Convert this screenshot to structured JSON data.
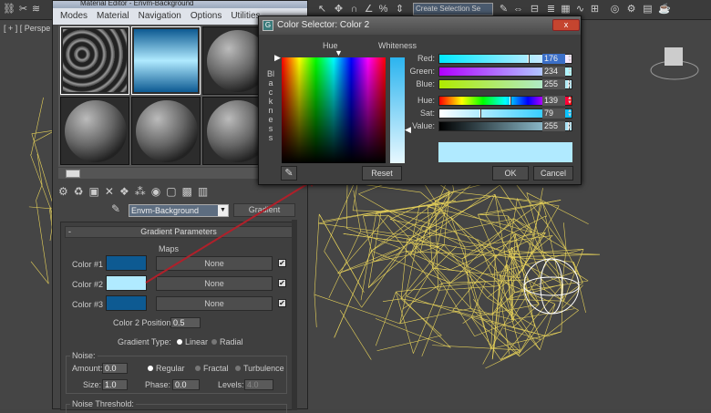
{
  "toolbar": {
    "selection_set_placeholder": "Create Selection Se",
    "icons": [
      "link-icon",
      "unlink-icon",
      "bind-icon",
      "select-icon",
      "move-icon",
      "snap-icon",
      "angle-snap-icon",
      "percent-snap-icon",
      "spinner-snap-icon",
      "edit-named-selection-icon",
      "mirror-icon",
      "align-icon",
      "layer-icon",
      "graphite-icon",
      "curve-editor-icon",
      "schematic-icon",
      "material-editor-icon",
      "render-setup-icon",
      "render-frame-icon",
      "render-icon"
    ]
  },
  "viewport": {
    "label": "[ + ] [ Perspe",
    "wire_color": "#e8d35a"
  },
  "material_editor": {
    "title": "Material Editor - Envm-Background",
    "menu": [
      "Modes",
      "Material",
      "Navigation",
      "Options",
      "Utilities"
    ],
    "map_name": "Envm-Background",
    "map_type": "Gradient",
    "rollout": {
      "title": "Gradient Parameters",
      "collapse": "-",
      "maps_label": "Maps",
      "colors": [
        {
          "label": "Color #1",
          "color": "#0d5a92",
          "map": "None",
          "checked": true
        },
        {
          "label": "Color #2",
          "color": "#b0eaff",
          "map": "None",
          "checked": true
        },
        {
          "label": "Color #3",
          "color": "#0d5a92",
          "map": "None",
          "checked": true
        }
      ],
      "color2_position_label": "Color 2 Position:",
      "color2_position": "0.5",
      "gradient_type_label": "Gradient Type:",
      "gradient_types": [
        "Linear",
        "Radial"
      ],
      "gradient_type_selected": "Linear",
      "noise_label": "Noise:",
      "amount_label": "Amount:",
      "amount": "0.0",
      "noise_types": [
        "Regular",
        "Fractal",
        "Turbulence"
      ],
      "noise_type_selected": "Regular",
      "size_label": "Size:",
      "size": "1.0",
      "phase_label": "Phase:",
      "phase": "0.0",
      "levels_label": "Levels:",
      "levels": "4.0",
      "noise_threshold_label": "Noise Threshold:"
    }
  },
  "color_selector": {
    "title": "Color Selector: Color 2",
    "close": "x",
    "hue_label": "Hue",
    "whiteness_label": "Whiteness",
    "blackness_label": "Blackness",
    "channels": [
      {
        "label": "Red:",
        "value": "176",
        "fraction": 0.69,
        "gradient": "linear-gradient(to right,#00eaff,#b0eaff 69%,#ffeaff)",
        "selected": true
      },
      {
        "label": "Green:",
        "value": "234",
        "fraction": 0.92,
        "gradient": "linear-gradient(to right,#b000ff,#b0eaff 92%,#b0ffff)"
      },
      {
        "label": "Blue:",
        "value": "255",
        "fraction": 1.0,
        "gradient": "linear-gradient(to right,#b0ea00,#b0eaff)"
      },
      {
        "label": "Hue:",
        "value": "139",
        "fraction": 0.545,
        "gradient": "linear-gradient(to right,#f00,#ff0 17%,#0f0 33%,#0ff 50%,#00f 67%,#f0f 83%,#f00)"
      },
      {
        "label": "Sat:",
        "value": "79",
        "fraction": 0.31,
        "gradient": "linear-gradient(to right,#fff,#00c0ff)"
      },
      {
        "label": "Value:",
        "value": "255",
        "fraction": 1.0,
        "gradient": "linear-gradient(to right,#000,#b0eaff)"
      }
    ],
    "current_color": "#b0eaff",
    "reset_label": "Reset",
    "ok_label": "OK",
    "cancel_label": "Cancel"
  }
}
